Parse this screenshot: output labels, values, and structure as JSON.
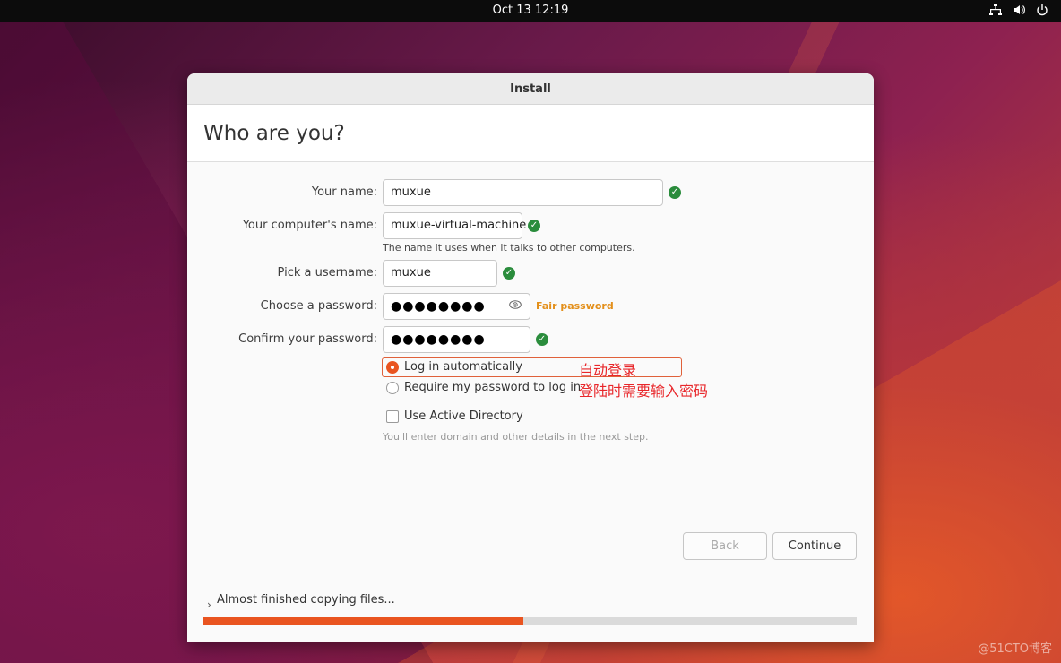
{
  "system": {
    "clock": "Oct 13  12:19",
    "tray_icons": [
      "network-icon",
      "volume-icon",
      "power-icon"
    ]
  },
  "window": {
    "title": "Install",
    "heading": "Who are you?"
  },
  "form": {
    "name_label": "Your name:",
    "name_value": "muxue",
    "computer_label": "Your computer's name:",
    "computer_value": "muxue-virtual-machine",
    "computer_hint": "The name it uses when it talks to other computers.",
    "username_label": "Pick a username:",
    "username_value": "muxue",
    "password_label": "Choose a password:",
    "password_value": "●●●●●●●●",
    "password_strength": "Fair password",
    "confirm_label": "Confirm your password:",
    "confirm_value": "●●●●●●●●",
    "login_auto_label": "Log in automatically",
    "login_auto_selected": true,
    "require_password_label": "Require my password to log in",
    "active_directory_label": "Use Active Directory",
    "active_directory_hint": "You'll enter domain and other details in the next step."
  },
  "annotations": {
    "auto_login": "自动登录",
    "require_password": "登陆时需要输入密码"
  },
  "buttons": {
    "back": "Back",
    "continue": "Continue"
  },
  "progress": {
    "label": "Almost finished copying files...",
    "fraction": 0.49
  },
  "colors": {
    "accent": "#e95420",
    "ok": "#2a8c3c",
    "strength": "#e38f1a",
    "annotation": "#e8262a"
  },
  "watermark": "@51CTO博客"
}
